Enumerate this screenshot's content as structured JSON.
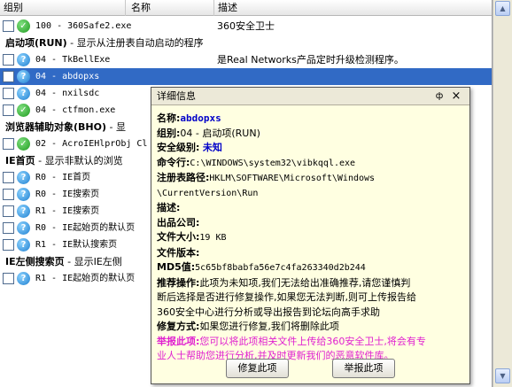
{
  "columns": {
    "group": "组别",
    "name": "名称",
    "desc": "描述"
  },
  "rows": [
    {
      "kind": "item",
      "status": "ok",
      "checked": false,
      "content": "100 - 360Safe2.exe",
      "desc": "360安全卫士"
    },
    {
      "kind": "group",
      "title": "启动项(RUN)",
      "desc": " - 显示从注册表自动启动的程序"
    },
    {
      "kind": "item",
      "status": "q",
      "content": "04 - TkBellExe",
      "desc": "是Real Networks产品定时升级检测程序。"
    },
    {
      "kind": "item",
      "status": "q",
      "content": "04 - abdopxs",
      "desc": "",
      "selected": true
    },
    {
      "kind": "item",
      "status": "q",
      "content": "04 - nxilsdc",
      "desc": ""
    },
    {
      "kind": "item",
      "status": "ok",
      "content": "04 - ctfmon.exe",
      "desc": ""
    },
    {
      "kind": "group",
      "title": "浏览器辅助对象(BHO)",
      "desc": " - 显"
    },
    {
      "kind": "item",
      "status": "ok",
      "content": "02 - AcroIEHlprObj Cl",
      "desc": ""
    },
    {
      "kind": "group",
      "title": "IE首页",
      "desc": " - 显示非默认的浏览"
    },
    {
      "kind": "item",
      "status": "q",
      "content": "R0 - IE首页",
      "desc": ""
    },
    {
      "kind": "item",
      "status": "q",
      "content": "R0 - IE搜索页",
      "desc": ""
    },
    {
      "kind": "item",
      "status": "q",
      "content": "R1 - IE搜索页",
      "desc": ""
    },
    {
      "kind": "item",
      "status": "q",
      "content": "R0 - IE起始页的默认页",
      "desc": ""
    },
    {
      "kind": "item",
      "status": "q",
      "content": "R1 - IE默认搜索页",
      "desc": ""
    },
    {
      "kind": "group",
      "title": "IE左侧搜索页",
      "desc": " - 显示IE左侧"
    },
    {
      "kind": "item",
      "status": "q",
      "content": "R1 - IE起始页的默认页",
      "desc": ""
    }
  ],
  "popup": {
    "title": "详细信息",
    "pin": "ф",
    "close": "×",
    "name_label": "名称:",
    "name_value": "abdopxs",
    "group_label": "组别:",
    "group_value": "04 - 启动项(RUN)",
    "security_label": "安全级别:",
    "security_value": "未知",
    "cmd_label": "命令行:",
    "cmd_value": "C:\\WINDOWS\\system32\\vibkqql.exe",
    "reg_label": "注册表路径:",
    "reg_value_1": "HKLM\\SOFTWARE\\Microsoft\\Windows",
    "reg_value_2": "\\CurrentVersion\\Run",
    "desc_label": "描述:",
    "publisher_label": "出品公司:",
    "size_label": "文件大小:",
    "size_value": "19 KB",
    "version_label": "文件版本:",
    "md5_label": "MD5值:",
    "md5_value": "5c65bf8babfa56e7c4fa263340d2b244",
    "recommend_label": "推荐操作:",
    "recommend_text_1": "此项为未知项,我们无法给出准确推荐,请您谨慎判",
    "recommend_text_2": "断后选择是否进行修复操作,如果您无法判断,则可上传报告给",
    "recommend_text_3": "360安全中心进行分析或导出报告到论坛向高手求助",
    "repair_label": "修复方式:",
    "repair_text": "如果您进行修复,我们将删除此项",
    "report_label": "举报此项:",
    "report_text_1": "您可以将此项相关文件上传给360安全卫士,将会有专",
    "report_text_2": "业人士帮助您进行分析,并及时更新我们的恶意软件库。",
    "btn_repair": "修复此项",
    "btn_report": "举报此项"
  },
  "colors": {
    "selected": "#316ac5",
    "link_blue": "#0000c8",
    "report_magenta": "#e020d0",
    "popup_bg": "#ffffe1"
  }
}
